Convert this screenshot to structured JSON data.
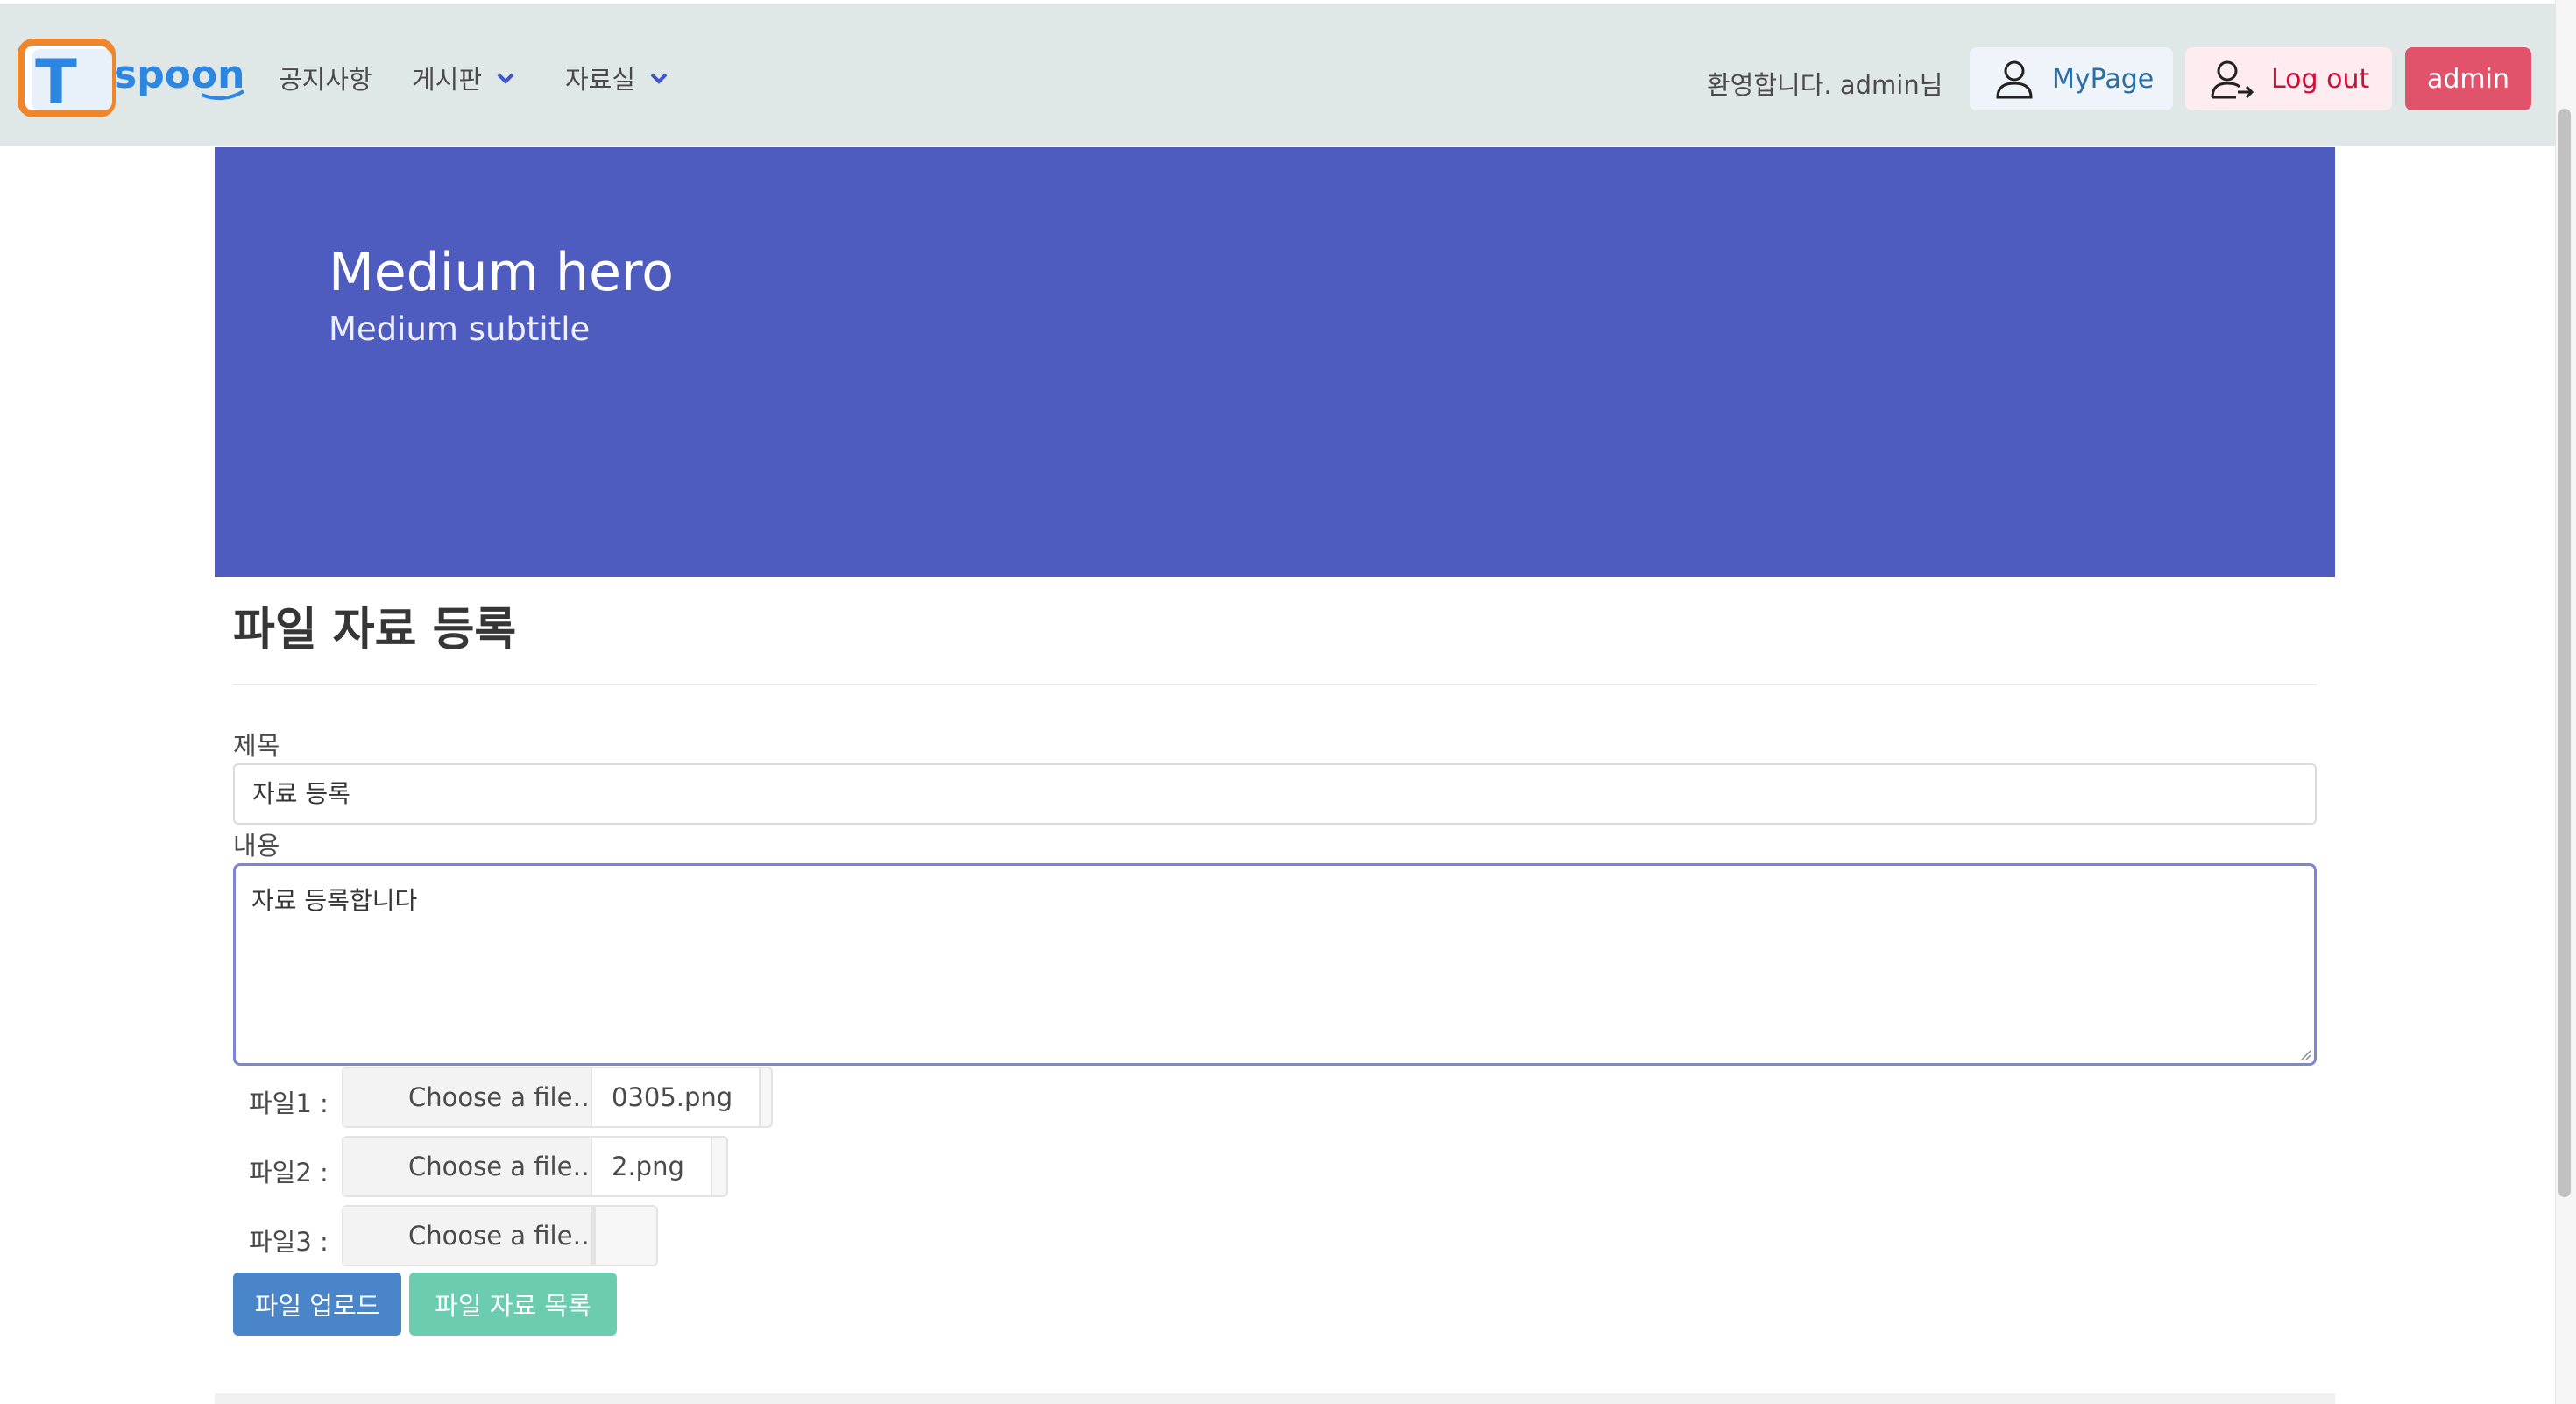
{
  "navbar": {
    "logo_text": "spoon",
    "logo_mark": "T",
    "items": [
      {
        "label": "공지사항"
      },
      {
        "label": "게시판"
      },
      {
        "label": "자료실"
      }
    ],
    "welcome": "환영합니다. admin님",
    "mypage_label": "MyPage",
    "logout_label": "Log out",
    "admin_label": "admin"
  },
  "hero": {
    "title": "Medium hero",
    "subtitle": "Medium subtitle"
  },
  "form": {
    "page_title": "파일 자료 등록",
    "title_label": "제목",
    "title_value": "자료 등록",
    "content_label": "내용",
    "content_value": "자료 등록합니다",
    "files": [
      {
        "label": "파일1 :",
        "cta": "Choose a file…",
        "file_name": "0305.png"
      },
      {
        "label": "파일2 :",
        "cta": "Choose a file…",
        "file_name": "2.png"
      },
      {
        "label": "파일3 :",
        "cta": "Choose a file…",
        "file_name": ""
      }
    ],
    "upload_button": "파일 업로드",
    "list_button": "파일 자료 목록"
  },
  "colors": {
    "navbar_bg": "#dfe8e6",
    "hero_bg": "#4e5cc0",
    "upload_button": "#4a84c9",
    "list_button": "#6cccb0",
    "admin_button": "#e0536a"
  }
}
